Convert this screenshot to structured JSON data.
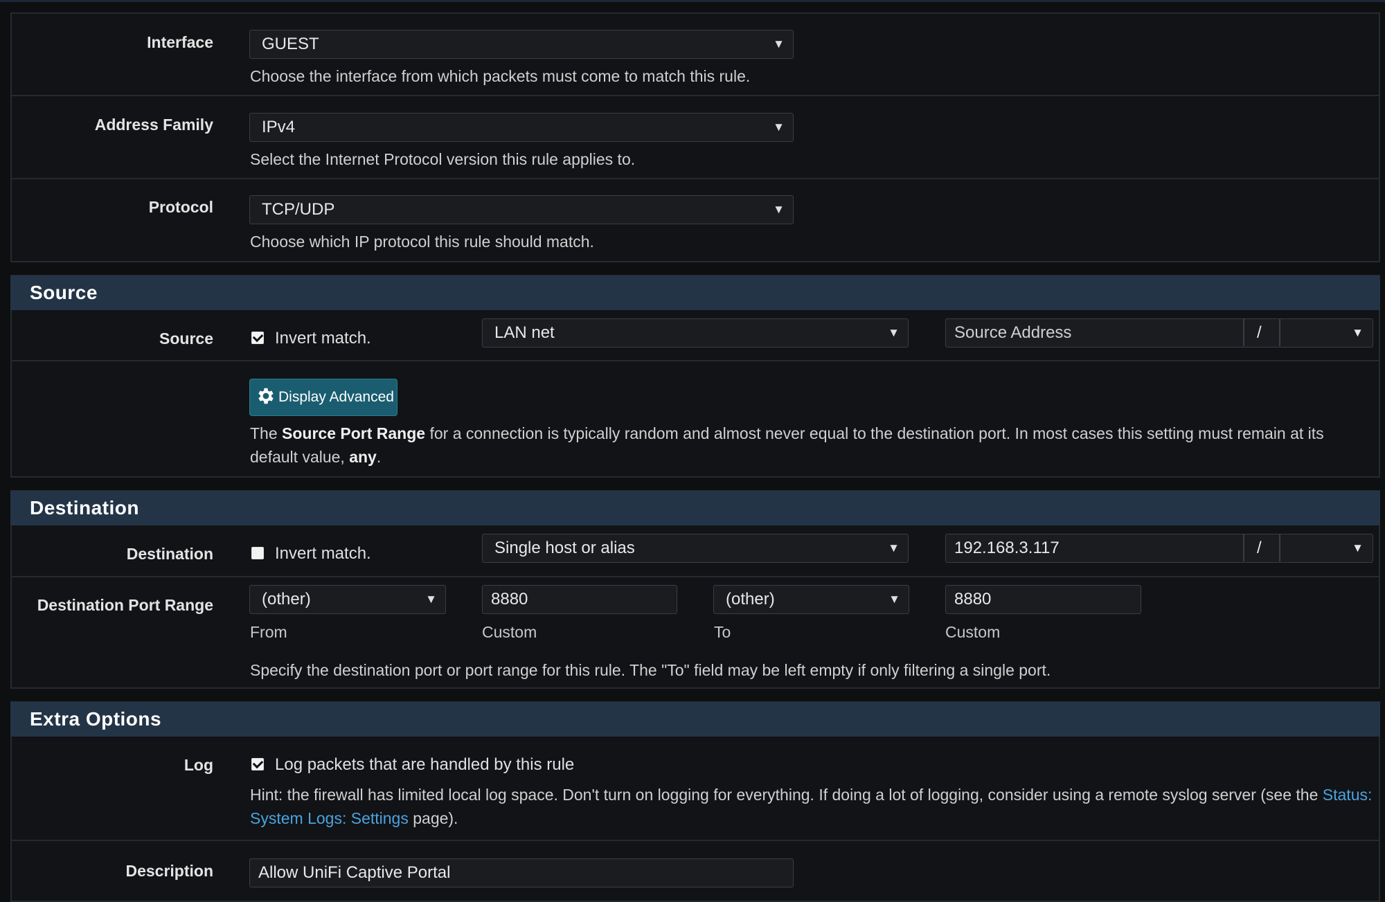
{
  "general": {
    "interface": {
      "label": "Interface",
      "value": "GUEST",
      "help": "Choose the interface from which packets must come to match this rule."
    },
    "address_family": {
      "label": "Address Family",
      "value": "IPv4",
      "help": "Select the Internet Protocol version this rule applies to."
    },
    "protocol": {
      "label": "Protocol",
      "value": "TCP/UDP",
      "help": "Choose which IP protocol this rule should match."
    }
  },
  "source": {
    "heading": "Source",
    "label": "Source",
    "invert_checked": true,
    "invert_label": "Invert match.",
    "type_value": "LAN net",
    "address_placeholder": "Source Address",
    "slash": "/",
    "mask_value": "",
    "advanced_button": "Display Advanced",
    "help_pre": "The ",
    "help_bold1": "Source Port Range",
    "help_mid": " for a connection is typically random and almost never equal to the destination port. In most cases this setting must remain at its default value, ",
    "help_bold2": "any",
    "help_post": "."
  },
  "destination": {
    "heading": "Destination",
    "label": "Destination",
    "invert_checked": false,
    "invert_label": "Invert match.",
    "type_value": "Single host or alias",
    "address_value": "192.168.3.117",
    "slash": "/",
    "mask_value": "",
    "port_range_label": "Destination Port Range",
    "from_value": "(other)",
    "from_custom": "8880",
    "to_value": "(other)",
    "to_custom": "8880",
    "from_sub": "From",
    "from_custom_sub": "Custom",
    "to_sub": "To",
    "to_custom_sub": "Custom",
    "help": "Specify the destination port or port range for this rule. The \"To\" field may be left empty if only filtering a single port."
  },
  "extra": {
    "heading": "Extra Options",
    "log_label": "Log",
    "log_checked": true,
    "log_text": "Log packets that are handled by this rule",
    "hint_pre": "Hint: the firewall has limited local log space. Don't turn on logging for everything. If doing a lot of logging, consider using a remote syslog server (see the ",
    "hint_link": "Status: System Logs: Settings",
    "hint_post": " page).",
    "description_label": "Description",
    "description_value": "Allow UniFi Captive  Portal"
  },
  "colors": {
    "panel_heading": "#243447",
    "button": "#1a5d70",
    "link": "#4aa3df"
  }
}
